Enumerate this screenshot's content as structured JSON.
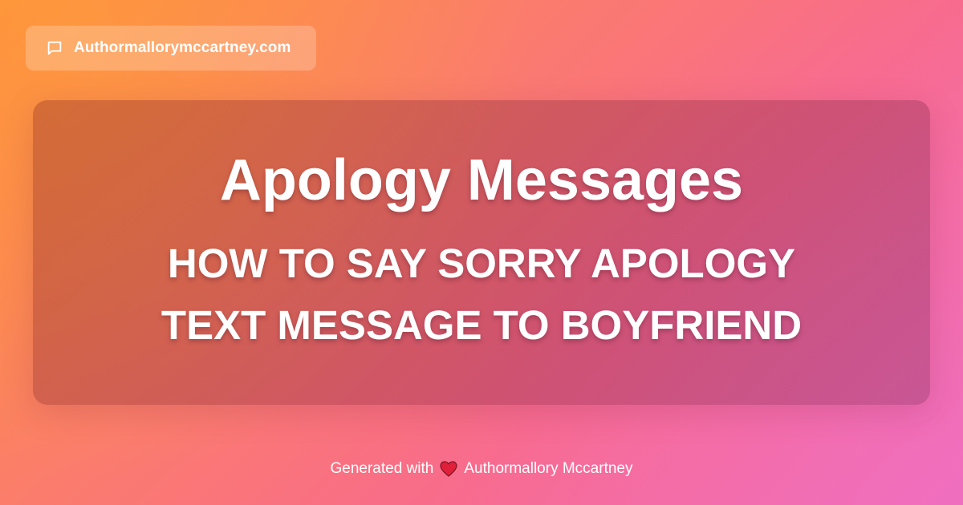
{
  "badge": {
    "icon": "chat-bubble-icon",
    "site": "Authormallorymccartney.com"
  },
  "card": {
    "title": "Apology Messages",
    "subtitle_line1": "HOW TO SAY SORRY APOLOGY",
    "subtitle_line2": "TEXT MESSAGE TO BOYFRIEND"
  },
  "footer": {
    "prefix": "Generated with",
    "icon": "heart-icon",
    "author": "Authormallory Mccartney"
  },
  "colors": {
    "gradient_start": "#fd8d3b",
    "gradient_end": "#f06fb8",
    "text": "#ffffff",
    "heart": "#e0203a"
  }
}
